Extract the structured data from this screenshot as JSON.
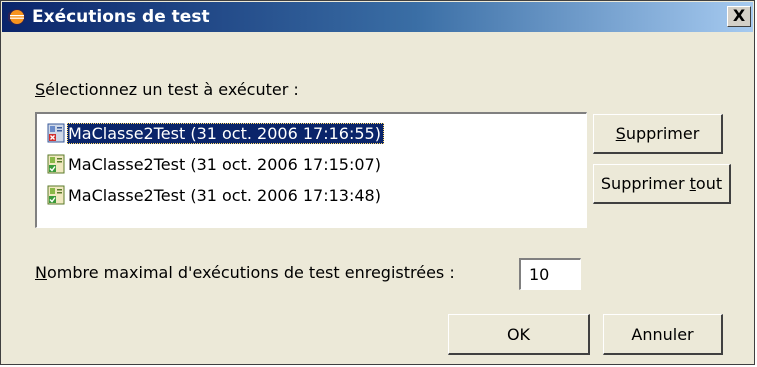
{
  "window": {
    "title": "Exécutions de test",
    "close_label": "X",
    "title_icon": "eclipse-icon"
  },
  "select_label": {
    "mnemonic": "S",
    "rest": "électionnez un test à exécuter :"
  },
  "runs": [
    {
      "label": "MaClasse2Test (31 oct. 2006 17:16:55)",
      "selected": true,
      "status": "error",
      "icon": "junit-error-icon"
    },
    {
      "label": "MaClasse2Test (31 oct. 2006 17:15:07)",
      "selected": false,
      "status": "ok",
      "icon": "junit-ok-icon"
    },
    {
      "label": "MaClasse2Test (31 oct. 2006 17:13:48)",
      "selected": false,
      "status": "ok",
      "icon": "junit-ok-icon"
    }
  ],
  "buttons": {
    "delete": {
      "mnemonic": "S",
      "rest": "upprimer"
    },
    "delete_all": {
      "before": "Supprimer ",
      "mnemonic": "t",
      "rest": "out"
    },
    "ok": "OK",
    "cancel": "Annuler"
  },
  "max_runs": {
    "label_mnemonic": "N",
    "label_rest": "ombre maximal d'exécutions de test enregistrées :",
    "value": "10"
  },
  "colors": {
    "selection": "#0a246a",
    "title_gradient_start": "#0a246a",
    "title_gradient_end": "#a6caf0",
    "dialog_bg": "#ece9d8"
  }
}
